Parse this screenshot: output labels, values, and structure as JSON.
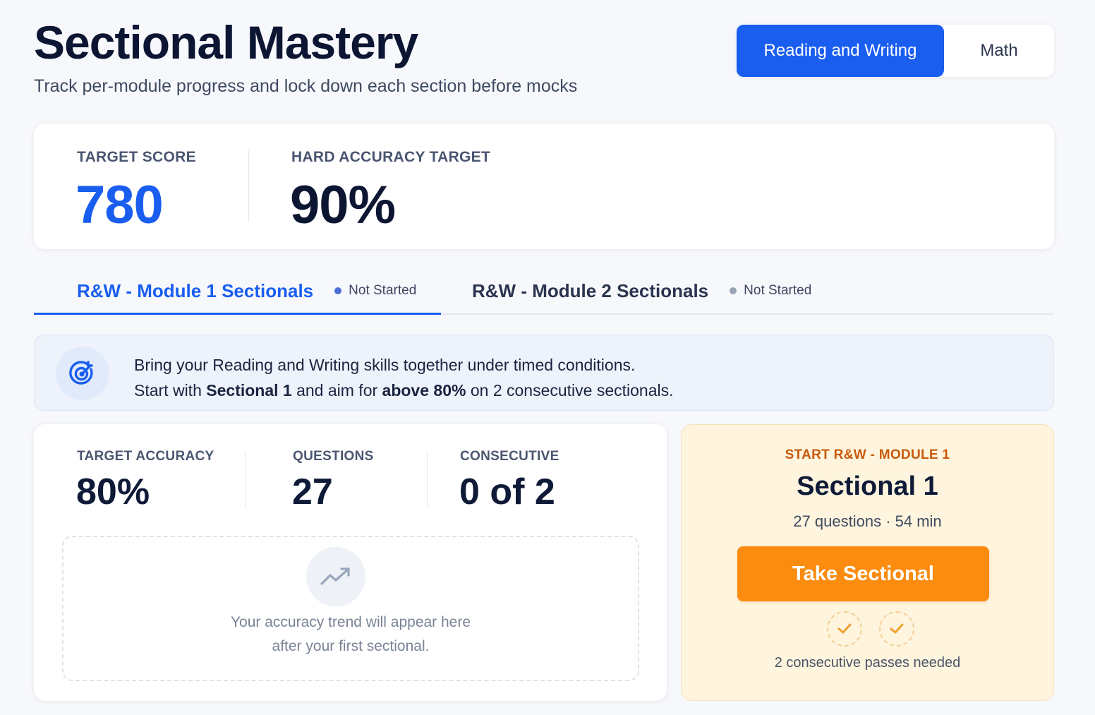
{
  "header": {
    "title": "Sectional Mastery",
    "subtitle": "Track per-module progress and lock down each section before mocks"
  },
  "section_toggle": {
    "options": [
      "Reading and Writing",
      "Math"
    ],
    "selected": "Reading and Writing"
  },
  "targets": {
    "target_score_label": "TARGET SCORE",
    "target_score_value": "780",
    "hard_accuracy_label": "HARD ACCURACY TARGET",
    "hard_accuracy_value": "90%"
  },
  "tabs": [
    {
      "label": "R&W - Module 1 Sectionals",
      "status": "Not Started",
      "active": true
    },
    {
      "label": "R&W - Module 2 Sectionals",
      "status": "Not Started",
      "active": false
    }
  ],
  "banner": {
    "icon": "target-icon",
    "line1": "Bring your Reading and Writing skills together under timed conditions.",
    "line2_pre": "Start with ",
    "line2_bold1": "Sectional 1",
    "line2_mid": " and aim for ",
    "line2_bold2": "above 80%",
    "line2_post": " on 2 consecutive sectionals."
  },
  "stats": {
    "target_accuracy_label": "TARGET ACCURACY",
    "target_accuracy_value": "80%",
    "questions_label": "QUESTIONS",
    "questions_value": "27",
    "consecutive_label": "CONSECUTIVE",
    "consecutive_value": "0 of 2"
  },
  "trend": {
    "icon": "trending-up-icon",
    "line1": "Your accuracy trend will appear here",
    "line2": "after your first sectional."
  },
  "cta": {
    "eyebrow": "START R&W - MODULE 1",
    "title": "Sectional 1",
    "meta": "27 questions · 54 min",
    "button": "Take Sectional",
    "passes_needed": 2,
    "footer": "2 consecutive passes needed"
  },
  "colors": {
    "accent": "#1a5ef0",
    "cta_orange": "#fb8c0f",
    "eyebrow_orange": "#c85a0c",
    "status_dot": "#5b6b8c"
  }
}
